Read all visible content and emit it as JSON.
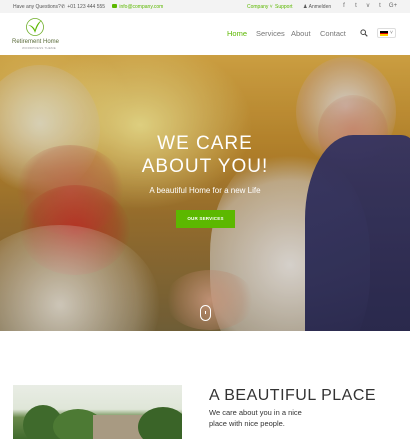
{
  "topbar": {
    "questions_label": "Have any Questions?",
    "phone": "+01 123 444 555",
    "email": "info@company.com",
    "company_link": "Company",
    "support_link": "Support",
    "login_link": "Anmelden",
    "social_icons": [
      "facebook-icon",
      "twitter-icon",
      "vimeo-icon",
      "tumblr-icon",
      "google-plus-icon"
    ],
    "social_glyphs": [
      "f",
      "t",
      "v",
      "t",
      "G+"
    ]
  },
  "header": {
    "logo_title": "Retirement Home",
    "logo_subtitle": "WORDPRESS THEME",
    "nav": [
      {
        "label": "Home",
        "active": true
      },
      {
        "label": "Services",
        "active": false
      },
      {
        "label": "About",
        "active": false
      },
      {
        "label": "Contact",
        "active": false
      }
    ],
    "language": "de"
  },
  "hero": {
    "title_line1": "WE CARE",
    "title_line2": "ABOUT YOU!",
    "subtitle": "A beautiful Home for a new Life",
    "button_label": "OUR SERVICES"
  },
  "section": {
    "title": "A BEAUTIFUL PLACE",
    "text": "We care about you in a nice place with nice people."
  },
  "colors": {
    "accent": "#5cb800",
    "topbar_bg": "#f3f3f3"
  }
}
